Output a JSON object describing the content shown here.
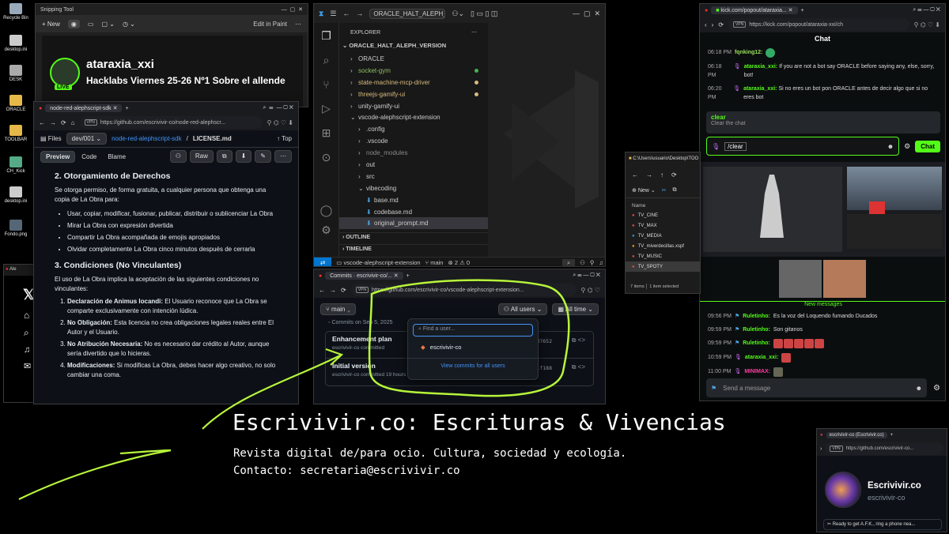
{
  "desktop": {
    "icons": [
      "Recycle Bin",
      "desktop.ini",
      "DESK",
      "ORACLE",
      "TOOLBAR",
      "CH_Kick",
      "desktop.ini",
      "Fondo.png"
    ]
  },
  "snipping": {
    "title": "Snipping Tool",
    "new_label": "New",
    "edit_paint": "Edit in Paint"
  },
  "stream": {
    "channel": "ataraxia_xxi",
    "live": "LIVE",
    "title": "Hacklabs Viernes 25-26 Nº1 Sobre el allende"
  },
  "github_license": {
    "tab_title": "node-red-alephscript-sdk",
    "url": "https://github.com/escrivivir-co/node-red-alephscr...",
    "files_label": "Files",
    "branch": "dev/001",
    "breadcrumb_repo": "node-red-alephscript-sdk",
    "breadcrumb_file": "LICENSE.md",
    "top_label": "Top",
    "tabs": [
      "Preview",
      "Code",
      "Blame"
    ],
    "raw": "Raw",
    "h2_section": "2. Otorgamiento de Derechos",
    "intro": "Se otorga permiso, de forma gratuita, a cualquier persona que obtenga una copia de La Obra para:",
    "bullets": [
      "Usar, copiar, modificar, fusionar, publicar, distribuir o sublicenciar La Obra",
      "Mirar La Obra con expresión divertida",
      "Compartir La Obra acompañada de emojis apropiados",
      "Olvidar completamente La Obra cinco minutos después de cerrarla"
    ],
    "h3_section": "3. Condiciones (No Vinculantes)",
    "intro3": "El uso de La Obra implica la aceptación de las siguientes condiciones no vinculantes:",
    "conditions": [
      {
        "b": "Declaración de Animus locandi:",
        "t": " El Usuario reconoce que La Obra se comparte exclusivamente con intención lúdica."
      },
      {
        "b": "No Obligación:",
        "t": " Esta licencia no crea obligaciones legales reales entre El Autor y el Usuario."
      },
      {
        "b": "No Atribución Necesaria:",
        "t": " No es necesario dar crédito al Autor, aunque sería divertido que lo hicieras."
      },
      {
        "b": "Modificaciones:",
        "t": " Si modificas La Obra, debes hacer algo creativo, no solo cambiar una coma."
      }
    ]
  },
  "vscode": {
    "search": "ORACLE_HALT_ALEPH_VERSI",
    "explorer_label": "EXPLORER",
    "root": "ORACLE_HALT_ALEPH_VERSION",
    "tree": [
      {
        "label": "ORACLE",
        "indent": 1,
        "kind": "folder",
        "color": "#ccc"
      },
      {
        "label": "socket-gym",
        "indent": 1,
        "kind": "folder",
        "color": "#8fbf63",
        "dot": "#4caf50"
      },
      {
        "label": "state-machine-mcp-driver",
        "indent": 1,
        "kind": "folder",
        "color": "#d7ba7d",
        "dot": "#d7ba7d"
      },
      {
        "label": "threejs-gamify-ui",
        "indent": 1,
        "kind": "folder",
        "color": "#d7ba7d",
        "dot": "#d7ba7d"
      },
      {
        "label": "unity-gamify-ui",
        "indent": 1,
        "kind": "folder",
        "color": "#ccc"
      },
      {
        "label": "vscode-alephscript-extension",
        "indent": 1,
        "kind": "open",
        "color": "#ccc"
      },
      {
        "label": ".config",
        "indent": 2,
        "kind": "folder",
        "color": "#ccc"
      },
      {
        "label": ".vscode",
        "indent": 2,
        "kind": "folder",
        "color": "#ccc"
      },
      {
        "label": "node_modules",
        "indent": 2,
        "kind": "folder",
        "color": "#888"
      },
      {
        "label": "out",
        "indent": 2,
        "kind": "folder",
        "color": "#ccc"
      },
      {
        "label": "src",
        "indent": 2,
        "kind": "folder",
        "color": "#ccc"
      },
      {
        "label": "vibecoding",
        "indent": 2,
        "kind": "open",
        "color": "#ccc"
      },
      {
        "label": "base.md",
        "indent": 3,
        "kind": "md",
        "color": "#ccc"
      },
      {
        "label": "codebase.md",
        "indent": 3,
        "kind": "md",
        "color": "#ccc"
      },
      {
        "label": "original_prompt.md",
        "indent": 3,
        "kind": "md",
        "color": "#ccc",
        "selected": true
      }
    ],
    "outline": "OUTLINE",
    "timeline": "TIMELINE",
    "status_repo": "vscode-alephscript-extension",
    "status_branch": "main",
    "status_errors": "2",
    "status_warnings": "0"
  },
  "github_commits": {
    "tab_title": "Commits · escrivivir-co/...",
    "url": "https://github.com/escrivivir-co/vscode-alephscript-extension...",
    "branch": "main",
    "all_users": "All users",
    "all_time": "All time",
    "commits_on": "Commits on Sep 5, 2025",
    "commits": [
      {
        "title": "Enhancement plan",
        "meta": "escrivivir-co committed",
        "sha": "ad7652"
      },
      {
        "title": "Initial version",
        "meta": "escrivivir-co committed 19 hours ago",
        "sha": "61f188"
      }
    ],
    "find_placeholder": "Find a user...",
    "user_option": "escrivivir-co",
    "view_all": "View commits for all users"
  },
  "kick": {
    "tab_url": "kick.com/popout/ataraxia...",
    "url": "https://kick.com/popout/ataraxia-xxi/ch",
    "title": "Chat",
    "messages": [
      {
        "time": "06:18 PM",
        "user": "fqnking12:",
        "text": "",
        "ucolor": "#9be15d"
      },
      {
        "time": "06:18 PM",
        "user": "ataraxia_xxi:",
        "text": "If you are not a bot say ORACLE before saying any, else, sorry, bot!",
        "ucolor": "#53fc18"
      },
      {
        "time": "06:20 PM",
        "user": "ataraxia_xxi:",
        "text": "Si no eres un bot pon ORACLE antes de decir algo que si no eres bot",
        "ucolor": "#53fc18"
      }
    ],
    "cmd": "clear",
    "cmd_desc": "Clear the chat",
    "input_value": "/clear",
    "chat_btn": "Chat",
    "new_messages": "New messages",
    "messages2": [
      {
        "time": "09:56 PM",
        "user": "Ruletinho:",
        "text": "Es la voz del Loquendo fumando Ducados",
        "ucolor": "#53fc18"
      },
      {
        "time": "09:59 PM",
        "user": "Ruletinho:",
        "text": "Son gitanos",
        "ucolor": "#53fc18"
      },
      {
        "time": "09:59 PM",
        "user": "Ruletinho:",
        "text": "",
        "ucolor": "#53fc18",
        "emotes": 5
      },
      {
        "time": "10:59 PM",
        "user": "ataraxia_xxi:",
        "text": "",
        "ucolor": "#53fc18",
        "emotes": 1
      },
      {
        "time": "11:00 PM",
        "user": "MINIMAX:",
        "text": "",
        "ucolor": "#ff3da0",
        "emotes": 1
      }
    ],
    "send_placeholder": "Send a message"
  },
  "explorer_win": {
    "path": "C:\\Users\\usuario\\Desktop\\TOO",
    "new_label": "New",
    "name_col": "Name",
    "files": [
      {
        "name": "TV_CINE",
        "color": "#e74c3c"
      },
      {
        "name": "TV_MAX",
        "color": "#e74c3c"
      },
      {
        "name": "TV_MEDIA",
        "color": "#3498db"
      },
      {
        "name": "TV_miverdecillas.xspf",
        "color": "#f39c12"
      },
      {
        "name": "TV_MUSIC",
        "color": "#e74c3c"
      },
      {
        "name": "TV_SPOTY",
        "color": "#e74c3c"
      }
    ],
    "status_items": "7 items",
    "status_selected": "1 item selected"
  },
  "x_app": {
    "tab": "Ale"
  },
  "overlay": {
    "heading": "Escrivivir.co: Escrituras & Vivencias",
    "subtitle": "Revista digital de/para ocio. Cultura, sociedad y ecología.",
    "contact": "Contacto: secretaria@escrivivir.co"
  },
  "profile_popup": {
    "tab": "escrivivir-co (Escrivivir.co)",
    "url": "https://github.com/escrivivir-co...",
    "name": "Escrivivir.co",
    "handle": "escrivivir-co",
    "status": "Ready to get A.F.K., ring a phone nea..."
  },
  "colors": {
    "accent_green": "#b7f53a",
    "kick_green": "#53fc18",
    "github_blue": "#4493f8"
  }
}
